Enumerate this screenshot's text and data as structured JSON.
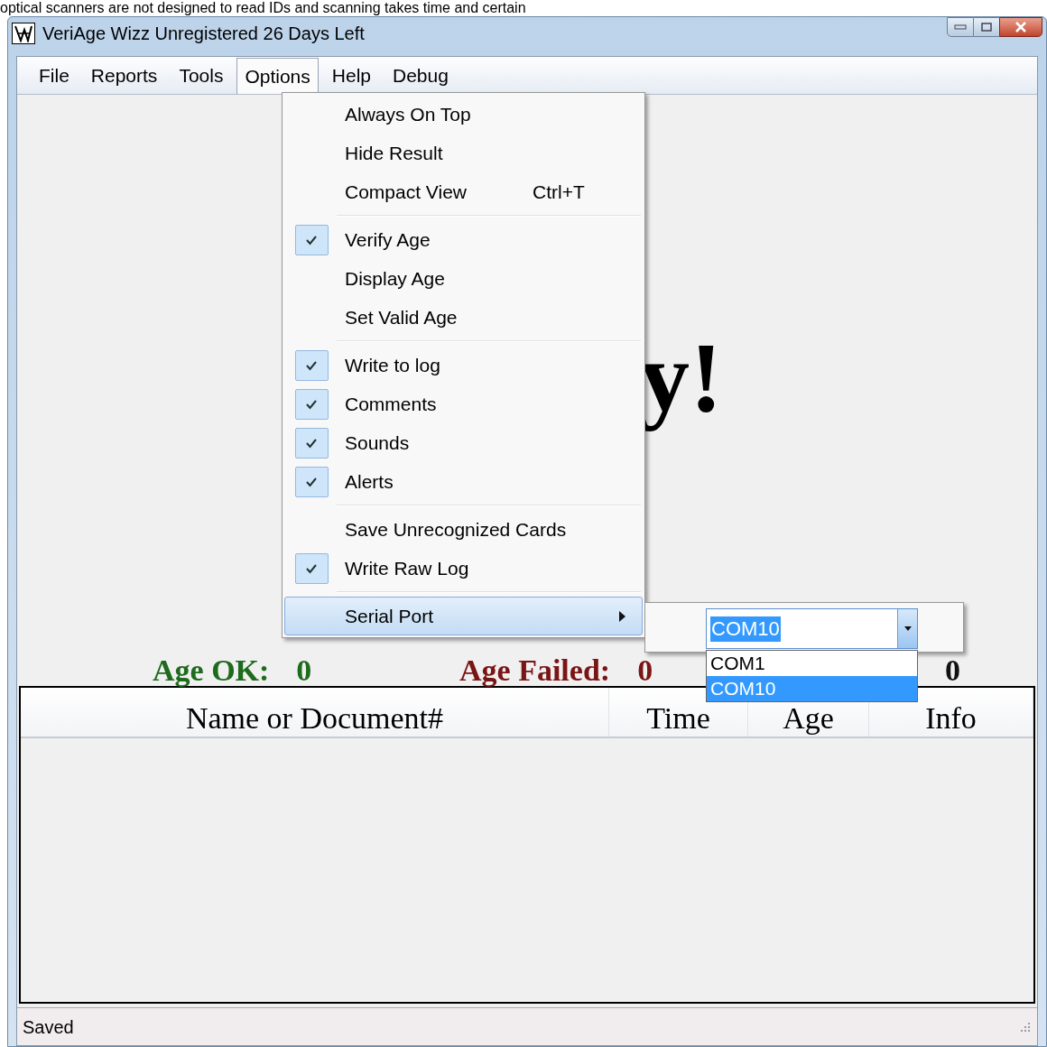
{
  "background_text": "optical scanners are not designed to read IDs and scanning takes time and certain",
  "window": {
    "title": "VeriAge Wizz Unregistered 26 Days Left"
  },
  "menu_bar": [
    {
      "label": "File",
      "selected": false
    },
    {
      "label": "Reports",
      "selected": false
    },
    {
      "label": "Tools",
      "selected": false
    },
    {
      "label": "Options",
      "selected": true
    },
    {
      "label": "Help",
      "selected": false
    },
    {
      "label": "Debug",
      "selected": false
    }
  ],
  "options_menu": [
    {
      "kind": "item",
      "label": "Always On Top",
      "checked": false,
      "selected": false
    },
    {
      "kind": "item",
      "label": "Hide Result",
      "checked": false,
      "selected": false
    },
    {
      "kind": "item",
      "label": "Compact View",
      "shortcut": "Ctrl+T",
      "checked": false,
      "selected": false
    },
    {
      "kind": "separator"
    },
    {
      "kind": "item",
      "label": "Verify Age",
      "checked": true,
      "selected": false
    },
    {
      "kind": "item",
      "label": "Display Age",
      "checked": false,
      "selected": false
    },
    {
      "kind": "item",
      "label": "Set Valid Age",
      "checked": false,
      "selected": false
    },
    {
      "kind": "separator"
    },
    {
      "kind": "item",
      "label": "Write to log",
      "checked": true,
      "selected": false
    },
    {
      "kind": "item",
      "label": "Comments",
      "checked": true,
      "selected": false
    },
    {
      "kind": "item",
      "label": "Sounds",
      "checked": true,
      "selected": false
    },
    {
      "kind": "item",
      "label": "Alerts",
      "checked": true,
      "selected": false
    },
    {
      "kind": "separator"
    },
    {
      "kind": "item",
      "label": "Save Unrecognized Cards",
      "checked": false,
      "selected": false
    },
    {
      "kind": "item",
      "label": "Write Raw Log",
      "checked": true,
      "selected": false
    },
    {
      "kind": "separator"
    },
    {
      "kind": "submenu",
      "label": "Serial Port",
      "checked": false,
      "selected": true
    }
  ],
  "serial_port_submenu": {
    "combo_value": "COM10",
    "options": [
      {
        "label": "COM1",
        "selected": false
      },
      {
        "label": "COM10",
        "selected": true
      }
    ]
  },
  "message": "y!",
  "counters": [
    {
      "label": "Age OK:",
      "value": "0",
      "color": "#1e6b1e"
    },
    {
      "label": "Age Failed:",
      "value": "0",
      "color": "#7a1515"
    },
    {
      "value": "0",
      "color": "#111111"
    }
  ],
  "table": {
    "columns": [
      "Name or Document#",
      "Time",
      "Age",
      "Info"
    ]
  },
  "status_bar": "Saved"
}
